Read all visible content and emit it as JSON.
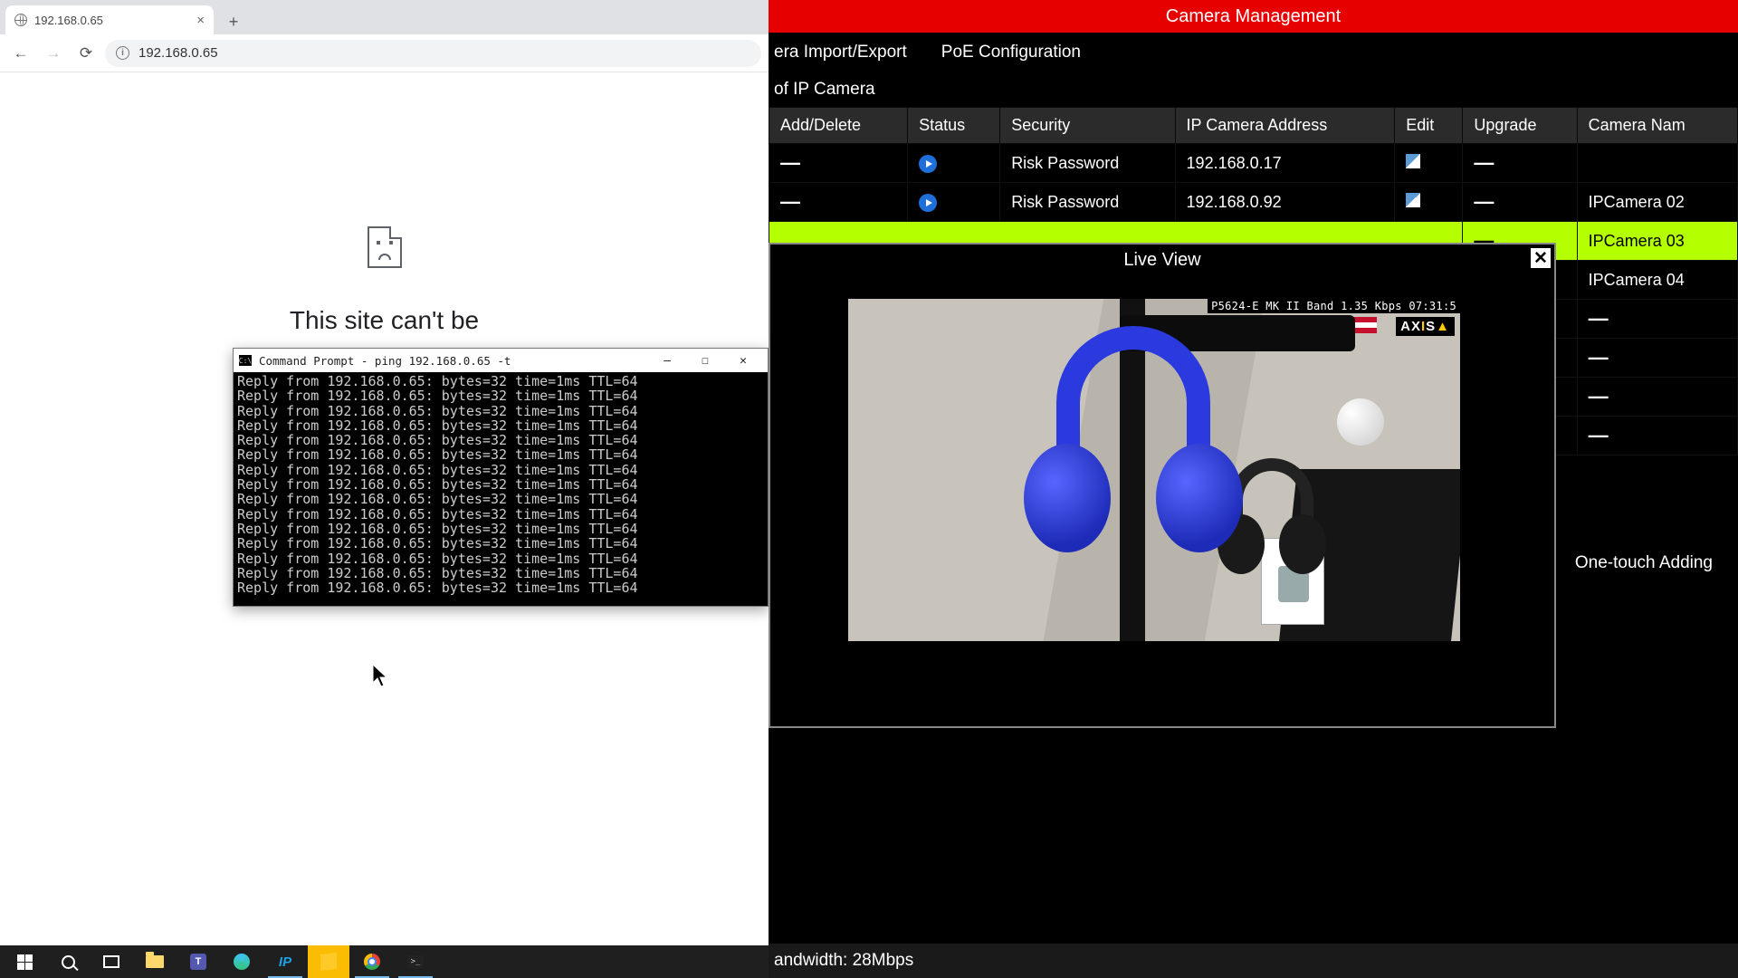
{
  "browser": {
    "tab_title": "192.168.0.65",
    "url": "192.168.0.65",
    "error_heading": "This site can't be"
  },
  "cmd": {
    "title": "Command Prompt - ping  192.168.0.65 -t",
    "line": "Reply from 192.168.0.65: bytes=32 time=1ms TTL=64",
    "line_count": 15
  },
  "nvr": {
    "title": "Camera Management",
    "tab1": "era Import/Export",
    "tab2": "PoE Configuration",
    "subhead": "of IP Camera",
    "cols": {
      "add": "Add/Delete",
      "status": "Status",
      "security": "Security",
      "addr": "IP Camera Address",
      "edit": "Edit",
      "upgrade": "Upgrade",
      "name": "Camera Nam"
    },
    "rows": [
      {
        "security": "Risk Password",
        "addr": "192.168.0.17",
        "name": ""
      },
      {
        "security": "Risk Password",
        "addr": "192.168.0.92",
        "name": "IPCamera 02"
      }
    ],
    "sel_name": "IPCamera 03",
    "row4_name": "IPCamera 04",
    "one_touch": "One-touch Adding",
    "bandwidth": "andwidth: 28Mbps"
  },
  "liveview": {
    "title": "Live View",
    "overlay": "P5624-E MK II Band  1.35 Kbps 07:31:5",
    "brand": "AXIS"
  },
  "taskbar": {
    "ip": "IP"
  }
}
